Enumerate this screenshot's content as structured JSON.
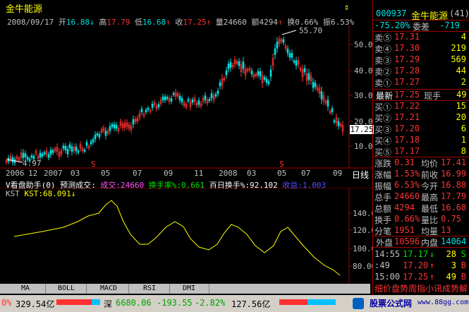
{
  "header": {
    "title": "金牛能源",
    "date": "2008/09/17",
    "open_label": "开",
    "open": "16.88",
    "open_arrow": "↓",
    "high_label": "高",
    "high": "17.79",
    "low_label": "低",
    "low": "16.68",
    "low_arrow": "↑",
    "close_label": "收",
    "close": "17.25",
    "close_arrow": "↑",
    "volume_label": "量",
    "volume": "24660",
    "amount_label": "额",
    "amount": "4294",
    "amount_arrow": "↑",
    "turnover_label": "换",
    "turnover": "0.66%",
    "amplitude_label": "振",
    "amplitude": "6.53%"
  },
  "main_chart": {
    "y_ticks": [
      "50.00",
      "40.00",
      "30.00",
      "20.00",
      "10.00"
    ],
    "peak_label": "55.70",
    "low_label": "4.97",
    "price_tag": "17.25",
    "split_marker": "S",
    "x_ticks": [
      "2006",
      "12",
      "2007",
      "03",
      "05",
      "07",
      "09",
      "11",
      "2008",
      "03",
      "05",
      "07",
      "09"
    ],
    "period": "日线",
    "colors": {
      "up": "#ff3232",
      "down": "#00e0e0",
      "axis": "#a00000"
    }
  },
  "indicator_bar": {
    "assistant": "V看盘助手(0)",
    "forecast_label": "预测成交:",
    "volume_label": "成交:",
    "volume": "24660",
    "turnover_label": "换手率%:",
    "turnover": "0.661",
    "hundred_label": "百日换手%:",
    "hundred": "92.102",
    "profit_label": "收益:",
    "profit": "1.003"
  },
  "kst": {
    "name": "KST",
    "label": "KST:",
    "value": "68.091",
    "arrow": "↓",
    "y_ticks": [
      "140.00",
      "120.00",
      "100.00",
      "80.00"
    ],
    "color": "#ffff00"
  },
  "tabs": [
    "MA",
    "BOLL",
    "MACD",
    "RSI",
    "DMI"
  ],
  "quote_panel": {
    "code": "000937",
    "name": "金牛能源",
    "count": "(41)",
    "weibi_label": "委比",
    "weibi": "-75.20%",
    "weicha_label": "委差",
    "weicha": "-719",
    "sells": [
      {
        "label": "卖⑤",
        "price": "17.31",
        "vol": "4"
      },
      {
        "label": "卖④",
        "price": "17.30",
        "vol": "219"
      },
      {
        "label": "卖③",
        "price": "17.29",
        "vol": "569"
      },
      {
        "label": "卖②",
        "price": "17.28",
        "vol": "44"
      },
      {
        "label": "卖①",
        "price": "17.27",
        "vol": "2"
      }
    ],
    "last_label": "最新",
    "last": "17.25",
    "lot_label": "现手",
    "lot": "49",
    "buys": [
      {
        "label": "买①",
        "price": "17.22",
        "vol": "15"
      },
      {
        "label": "买②",
        "price": "17.21",
        "vol": "20"
      },
      {
        "label": "买③",
        "price": "17.20",
        "vol": "6"
      },
      {
        "label": "买④",
        "price": "17.18",
        "vol": "1"
      },
      {
        "label": "买⑤",
        "price": "17.17",
        "vol": "8"
      }
    ],
    "stats": [
      {
        "l1": "涨跌",
        "v1": "0.31",
        "l2": "均价",
        "v2": "17.41"
      },
      {
        "l1": "涨幅",
        "v1": "1.53%",
        "l2": "前收",
        "v2": "16.99"
      },
      {
        "l1": "振幅",
        "v1": "6.53%",
        "l2": "今开",
        "v2": "16.88"
      },
      {
        "l1": "总手",
        "v1": "24660",
        "l2": "最高",
        "v2": "17.79"
      },
      {
        "l1": "总额",
        "v1": "4294",
        "l2": "最低",
        "v2": "16.68"
      },
      {
        "l1": "换手",
        "v1": "0.66%",
        "l2": "量比",
        "v2": "0.75"
      },
      {
        "l1": "分笔",
        "v1": "1951",
        "l2": "均量",
        "v2": "13"
      }
    ],
    "outer_label": "外盘",
    "outer": "10596",
    "inner_label": "内盘",
    "inner": "14064",
    "ticks": [
      {
        "time": "14:55",
        "price": "17.17",
        "arrow": "↓",
        "vol": "28",
        "side": "S"
      },
      {
        "time": ":49",
        "price": "17.20",
        "arrow": "↑",
        "vol": "3",
        "side": "B"
      },
      {
        "time": "15:00",
        "price": "17.25",
        "arrow": "↑",
        "vol": "49",
        "side": "B"
      }
    ],
    "bottom_tabs": "细价盘势周指小讯成势解"
  },
  "status": {
    "sh_change": "0%",
    "sh_amount": "329.54亿",
    "sz_label": "深",
    "sz_index": "6680.06",
    "sz_change": "-193.55",
    "sz_percent": "-2.82%",
    "sz_amount": "127.56亿",
    "logo_text": "股票公式网",
    "logo_url": "www.88gg.com"
  }
}
